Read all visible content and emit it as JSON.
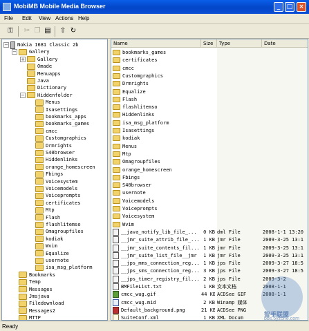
{
  "window": {
    "title": "MobiMB Mobile Media Browser"
  },
  "menubar": [
    {
      "label": "File"
    },
    {
      "label": "Edit"
    },
    {
      "label": "View"
    },
    {
      "label": "Actions"
    },
    {
      "label": "Help"
    }
  ],
  "tree": [
    {
      "label": "Nokia 1681 Classic 2b",
      "level": 0,
      "toggle": "-",
      "icon": "phone"
    },
    {
      "label": "Gallery",
      "level": 1,
      "toggle": "-",
      "icon": "folder"
    },
    {
      "label": "Gallery",
      "level": 2,
      "toggle": "+",
      "icon": "folder"
    },
    {
      "label": "Omade",
      "level": 2,
      "toggle": "",
      "icon": "folder"
    },
    {
      "label": "Menuapps",
      "level": 2,
      "toggle": "",
      "icon": "folder"
    },
    {
      "label": "Java",
      "level": 2,
      "toggle": "",
      "icon": "folder"
    },
    {
      "label": "Dictionary",
      "level": 2,
      "toggle": "",
      "icon": "folder"
    },
    {
      "label": "Hiddenfolder",
      "level": 2,
      "toggle": "-",
      "icon": "folder"
    },
    {
      "label": "Menus",
      "level": 3,
      "toggle": "",
      "icon": "folder"
    },
    {
      "label": "Isasettings",
      "level": 3,
      "toggle": "",
      "icon": "folder"
    },
    {
      "label": "bookmarks_apps",
      "level": 3,
      "toggle": "",
      "icon": "folder"
    },
    {
      "label": "bookmarks_games",
      "level": 3,
      "toggle": "",
      "icon": "folder"
    },
    {
      "label": "cmcc",
      "level": 3,
      "toggle": "",
      "icon": "folder"
    },
    {
      "label": "Customgraphics",
      "level": 3,
      "toggle": "",
      "icon": "folder"
    },
    {
      "label": "Drmrights",
      "level": 3,
      "toggle": "",
      "icon": "folder"
    },
    {
      "label": "S40browser",
      "level": 3,
      "toggle": "",
      "icon": "folder"
    },
    {
      "label": "Hiddenlinks",
      "level": 3,
      "toggle": "",
      "icon": "folder"
    },
    {
      "label": "orange_homescreen",
      "level": 3,
      "toggle": "",
      "icon": "folder"
    },
    {
      "label": "Fbings",
      "level": 3,
      "toggle": "",
      "icon": "folder"
    },
    {
      "label": "Voicesystem",
      "level": 3,
      "toggle": "",
      "icon": "folder"
    },
    {
      "label": "Voicemodels",
      "level": 3,
      "toggle": "",
      "icon": "folder"
    },
    {
      "label": "Voiceprompts",
      "level": 3,
      "toggle": "",
      "icon": "folder"
    },
    {
      "label": "certificates",
      "level": 3,
      "toggle": "",
      "icon": "folder"
    },
    {
      "label": "Mtp",
      "level": 3,
      "toggle": "",
      "icon": "folder"
    },
    {
      "label": "Flash",
      "level": 3,
      "toggle": "",
      "icon": "folder"
    },
    {
      "label": "flashlitemso",
      "level": 3,
      "toggle": "",
      "icon": "folder"
    },
    {
      "label": "Omagroupfiles",
      "level": 3,
      "toggle": "",
      "icon": "folder"
    },
    {
      "label": "kodiak",
      "level": 3,
      "toggle": "",
      "icon": "folder"
    },
    {
      "label": "Wvim",
      "level": 3,
      "toggle": "",
      "icon": "folder"
    },
    {
      "label": "Equalize",
      "level": 3,
      "toggle": "",
      "icon": "folder"
    },
    {
      "label": "usernote",
      "level": 3,
      "toggle": "",
      "icon": "folder"
    },
    {
      "label": "isa_msg_platform",
      "level": 3,
      "toggle": "",
      "icon": "folder"
    },
    {
      "label": "Bookmarks",
      "level": 1,
      "toggle": "",
      "icon": "folder"
    },
    {
      "label": "Temp",
      "level": 1,
      "toggle": "",
      "icon": "folder"
    },
    {
      "label": "Messages",
      "level": 1,
      "toggle": "",
      "icon": "folder"
    },
    {
      "label": "Jmsjava",
      "level": 1,
      "toggle": "",
      "icon": "folder"
    },
    {
      "label": "Filedownload",
      "level": 1,
      "toggle": "",
      "icon": "folder"
    },
    {
      "label": "Messages2",
      "level": 1,
      "toggle": "",
      "icon": "folder"
    },
    {
      "label": "MTTP",
      "level": 1,
      "toggle": "",
      "icon": "folder"
    }
  ],
  "list": {
    "columns": [
      {
        "label": "Name"
      },
      {
        "label": "Size"
      },
      {
        "label": "Type"
      },
      {
        "label": "Date"
      }
    ],
    "rows": [
      {
        "name": "bookmarks_games",
        "size": "",
        "type": "",
        "date": "",
        "icon": "folder"
      },
      {
        "name": "certificates",
        "size": "",
        "type": "",
        "date": "",
        "icon": "folder"
      },
      {
        "name": "cmcc",
        "size": "",
        "type": "",
        "date": "",
        "icon": "folder"
      },
      {
        "name": "Customgraphics",
        "size": "",
        "type": "",
        "date": "",
        "icon": "folder"
      },
      {
        "name": "Drmrights",
        "size": "",
        "type": "",
        "date": "",
        "icon": "folder"
      },
      {
        "name": "Equalize",
        "size": "",
        "type": "",
        "date": "",
        "icon": "folder"
      },
      {
        "name": "Flash",
        "size": "",
        "type": "",
        "date": "",
        "icon": "folder"
      },
      {
        "name": "flashlitemso",
        "size": "",
        "type": "",
        "date": "",
        "icon": "folder"
      },
      {
        "name": "Hiddenlinks",
        "size": "",
        "type": "",
        "date": "",
        "icon": "folder"
      },
      {
        "name": "isa_msg_platform",
        "size": "",
        "type": "",
        "date": "",
        "icon": "folder"
      },
      {
        "name": "Isasettings",
        "size": "",
        "type": "",
        "date": "",
        "icon": "folder"
      },
      {
        "name": "kodiak",
        "size": "",
        "type": "",
        "date": "",
        "icon": "folder"
      },
      {
        "name": "Menus",
        "size": "",
        "type": "",
        "date": "",
        "icon": "folder"
      },
      {
        "name": "Mtp",
        "size": "",
        "type": "",
        "date": "",
        "icon": "folder"
      },
      {
        "name": "Omagroupfiles",
        "size": "",
        "type": "",
        "date": "",
        "icon": "folder"
      },
      {
        "name": "orange_homescreen",
        "size": "",
        "type": "",
        "date": "",
        "icon": "folder"
      },
      {
        "name": "Fbings",
        "size": "",
        "type": "",
        "date": "",
        "icon": "folder"
      },
      {
        "name": "S40browser",
        "size": "",
        "type": "",
        "date": "",
        "icon": "folder"
      },
      {
        "name": "usernote",
        "size": "",
        "type": "",
        "date": "",
        "icon": "folder"
      },
      {
        "name": "Voicemodels",
        "size": "",
        "type": "",
        "date": "",
        "icon": "folder"
      },
      {
        "name": "Voiceprompts",
        "size": "",
        "type": "",
        "date": "",
        "icon": "folder"
      },
      {
        "name": "Voicesystem",
        "size": "",
        "type": "",
        "date": "",
        "icon": "folder"
      },
      {
        "name": "Wvim",
        "size": "",
        "type": "",
        "date": "",
        "icon": "folder"
      },
      {
        "name": "__java_notify_lib_file_...",
        "size": "0 KB",
        "type": "dml File",
        "date": "2008-1-1 13:20",
        "icon": "doc"
      },
      {
        "name": "__jmr_suite_attrib_file_...",
        "size": "1 KB",
        "type": "jmr File",
        "date": "2009-3-25 13:1",
        "icon": "doc"
      },
      {
        "name": "__jmr_suite_contents_fil...",
        "size": "1 KB",
        "type": "jmr File",
        "date": "2009-3-25 13:1",
        "icon": "doc"
      },
      {
        "name": "__jmr_suite_list_file__jmr",
        "size": "1 KB",
        "type": "jmr File",
        "date": "2009-3-25 13:1",
        "icon": "doc"
      },
      {
        "name": "__jps_mms_connection_reg...",
        "size": "1 KB",
        "type": "jps File",
        "date": "2009-3-27 18:5",
        "icon": "doc"
      },
      {
        "name": "__jps_sms_connection_reg...",
        "size": "3 KB",
        "type": "jps File",
        "date": "2009-3-27 18:5",
        "icon": "doc"
      },
      {
        "name": "__jps_timer_registry_fil...",
        "size": "2 KB",
        "type": "jps File",
        "date": "2009-3-2",
        "icon": "doc"
      },
      {
        "name": "BMFileList.txt",
        "size": "1 KB",
        "type": "文本文档",
        "date": "2008-1-1",
        "icon": "doc"
      },
      {
        "name": "cmcc_wug.gif",
        "size": "44 KB",
        "type": "ACDSee GIF",
        "date": "2008-1-1",
        "icon": "img"
      },
      {
        "name": "cmcc_wug.mid",
        "size": "2 KB",
        "type": "Winamp 媒体",
        "date": "",
        "icon": "snd"
      },
      {
        "name": "Default_background.png",
        "size": "21 KB",
        "type": "ACDSee PNG",
        "date": "",
        "icon": "png"
      },
      {
        "name": "SuiteConf.xml",
        "size": "1 KB",
        "type": "XML Docum",
        "date": "",
        "icon": "xml"
      }
    ]
  },
  "status": {
    "text": "Ready"
  },
  "watermark": {
    "brand": "智手联盟",
    "url": "bbs.5yzone.com"
  }
}
